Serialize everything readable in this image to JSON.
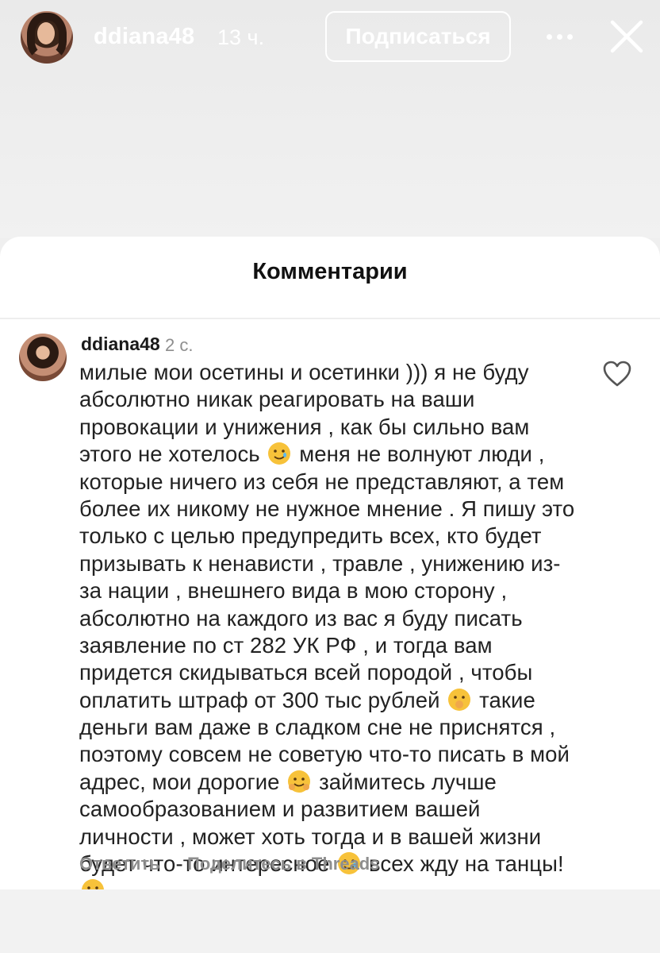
{
  "story": {
    "username": "ddiana48",
    "time": "13 ч.",
    "subscribe_label": "Подписаться",
    "more_icon": "more-horizontal-icon",
    "close_icon": "close-icon"
  },
  "comments_sheet": {
    "title": "Комментарии",
    "comment": {
      "username": "ddiana48",
      "time": "2 с.",
      "like_icon": "heart-outline-icon",
      "text_lines": [
        [
          "милые мои осетины и осетинки ))) я не буду"
        ],
        [
          "абсолютно никак реагировать на ваши"
        ],
        [
          "провокации и унижения , как бы сильно вам"
        ],
        [
          "этого не хотелось ",
          "🥲",
          " меня не волнуют люди ,"
        ],
        [
          "которые ничего из себя не представляют, а тем"
        ],
        [
          "более их никому не нужное мнение . Я пишу это"
        ],
        [
          "только с целью предупредить всех, кто будет"
        ],
        [
          "призывать к ненависти , травле , унижению из-"
        ],
        [
          "за нации , внешнего вида в мою сторону ,"
        ],
        [
          "абсолютно на каждого из вас я буду писать"
        ],
        [
          "заявление по ст 282 УК РФ , и тогда вам"
        ],
        [
          "придется скидываться всей породой , чтобы"
        ],
        [
          "оплатить штраф от 300 тыс рублей ",
          "🤭",
          " такие"
        ],
        [
          "деньги вам даже в сладком сне не приснятся ,"
        ],
        [
          "поэтому совсем не советую что-то писать в мой"
        ],
        [
          "адрес, мои дорогие ",
          "🤗",
          " займитесь лучше"
        ],
        [
          "самообразованием и развитием вашей"
        ],
        [
          "личности , может хоть тогда и в вашей жизни"
        ],
        [
          "будет что-то интересное ",
          "🥲",
          " всех жду на танцы!"
        ],
        [
          "😘"
        ]
      ]
    },
    "reply_label": "Ответить",
    "share_label": "Поделитесь в Threads"
  },
  "colors": {
    "story_bg": "#ececec",
    "sheet_bg": "#ffffff",
    "text_primary": "#222222",
    "text_secondary": "#8e8e8e",
    "header_text": "#ffffff",
    "emoji_yellow": "#f7c23a"
  }
}
